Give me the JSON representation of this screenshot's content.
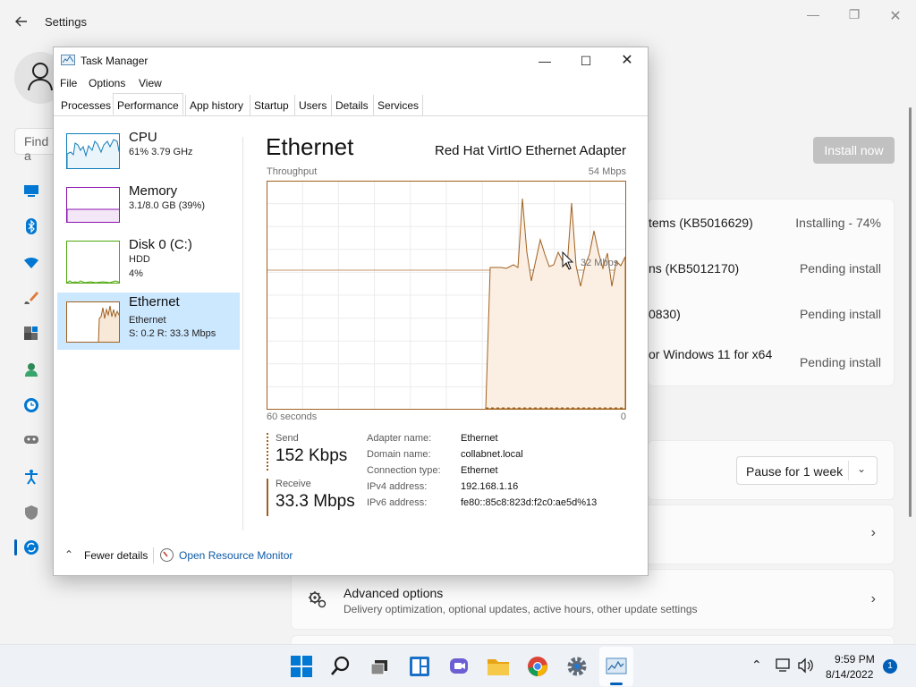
{
  "settings": {
    "title": "Settings",
    "find_placeholder": "Find a",
    "install_now": "Install now",
    "updates": [
      {
        "name": "tems (KB5016629)",
        "status": "Installing - 74%"
      },
      {
        "name": "ns (KB5012170)",
        "status": "Pending install"
      },
      {
        "name": "0830)",
        "status": "Pending install"
      },
      {
        "name": "or Windows 11 for x64",
        "status": "Pending install"
      }
    ],
    "pause_label": "Pause for 1 week",
    "advanced": {
      "title": "Advanced options",
      "subtitle": "Delivery optimization, optional updates, active hours, other update settings"
    }
  },
  "task_manager": {
    "title": "Task Manager",
    "menu": [
      "File",
      "Options",
      "View"
    ],
    "tabs": [
      "Processes",
      "Performance",
      "App history",
      "Startup",
      "Users",
      "Details",
      "Services"
    ],
    "active_tab": "Performance",
    "resources": [
      {
        "name": "CPU",
        "line1": "61% 3.79 GHz",
        "line2": "",
        "color": "#117dbb"
      },
      {
        "name": "Memory",
        "line1": "3.1/8.0 GB (39%)",
        "line2": "",
        "color": "#8b12ae"
      },
      {
        "name": "Disk 0 (C:)",
        "line1": "HDD",
        "line2": "4%",
        "color": "#4da60c"
      },
      {
        "name": "Ethernet",
        "line1": "Ethernet",
        "line2": "S: 0.2 R: 33.3 Mbps",
        "color": "#a0611f"
      }
    ],
    "selected_resource": "Ethernet",
    "detail": {
      "title": "Ethernet",
      "adapter": "Red Hat VirtIO Ethernet Adapter",
      "throughput_label": "Throughput",
      "max_label": "54 Mbps",
      "mid_label": "32 Mbps",
      "time_left": "60 seconds",
      "time_right": "0",
      "send_label": "Send",
      "send_value": "152 Kbps",
      "receive_label": "Receive",
      "receive_value": "33.3 Mbps",
      "properties": [
        {
          "key": "Adapter name:",
          "value": "Ethernet"
        },
        {
          "key": "Domain name:",
          "value": "collabnet.local"
        },
        {
          "key": "Connection type:",
          "value": "Ethernet"
        },
        {
          "key": "IPv4 address:",
          "value": "192.168.1.16"
        },
        {
          "key": "IPv6 address:",
          "value": "fe80::85c8:823d:f2c0:ae5d%13"
        }
      ]
    },
    "footer": {
      "fewer_details": "Fewer details",
      "open_resource_monitor": "Open Resource Monitor"
    }
  },
  "taskbar": {
    "time": "9:59 PM",
    "date": "8/14/2022",
    "notifications": "1"
  },
  "colors": {
    "ethernet": "#a0611f",
    "accent": "#005fb8",
    "selection": "#cce8ff"
  }
}
